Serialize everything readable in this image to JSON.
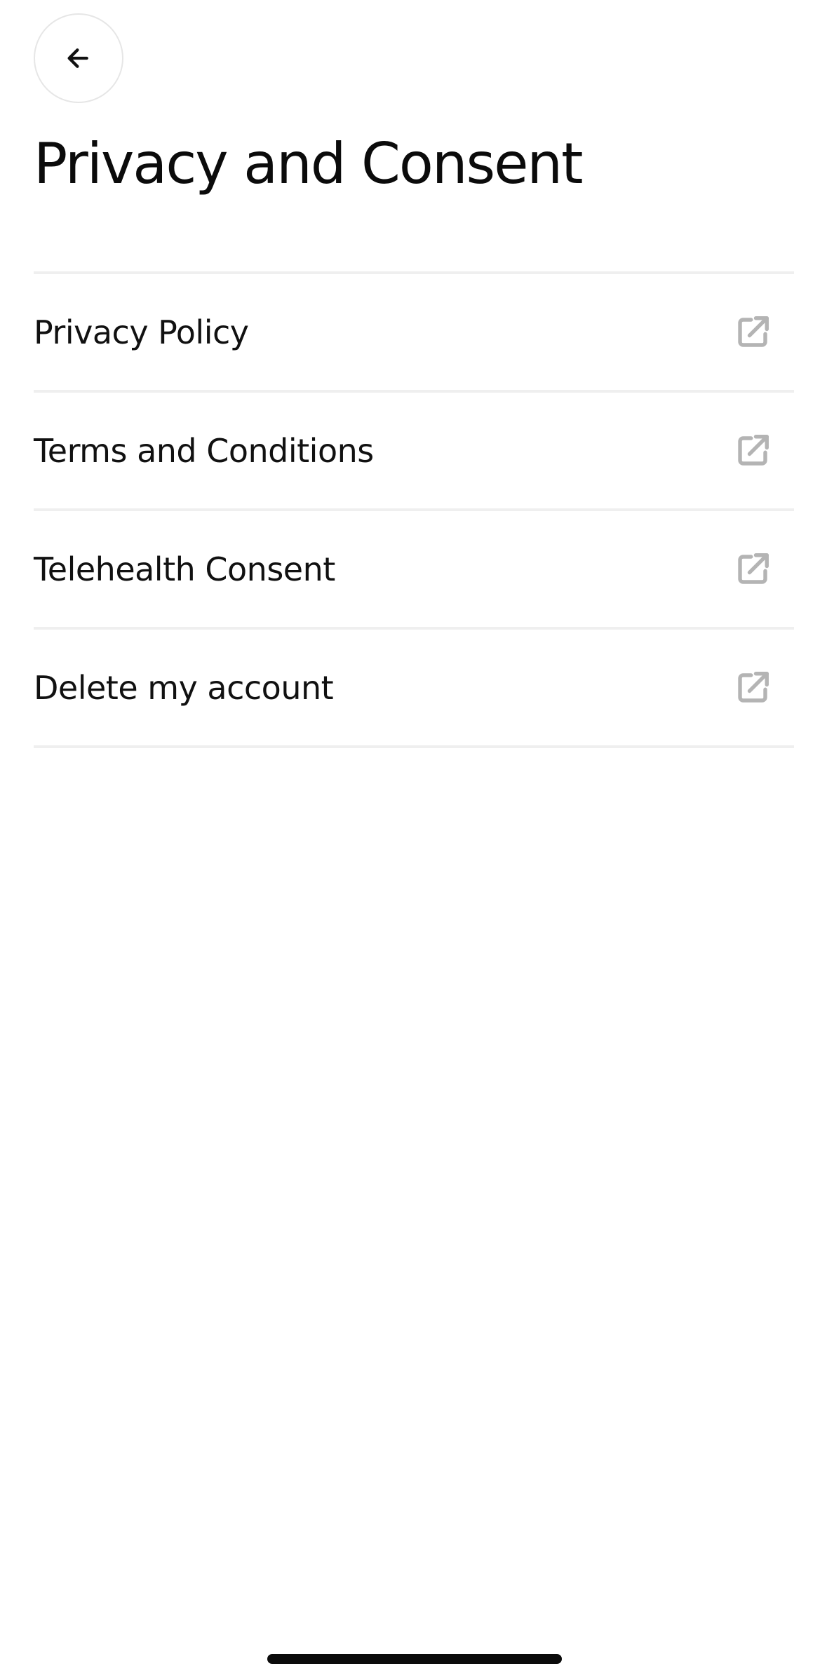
{
  "header": {
    "back_icon": "arrow-left-icon",
    "title": "Privacy and Consent"
  },
  "menu": {
    "item_icon": "external-link-icon",
    "icon_color": "#b4b4b4",
    "items": [
      {
        "label": "Privacy Policy"
      },
      {
        "label": "Terms and Conditions"
      },
      {
        "label": "Telehealth Consent"
      },
      {
        "label": "Delete my account"
      }
    ]
  }
}
